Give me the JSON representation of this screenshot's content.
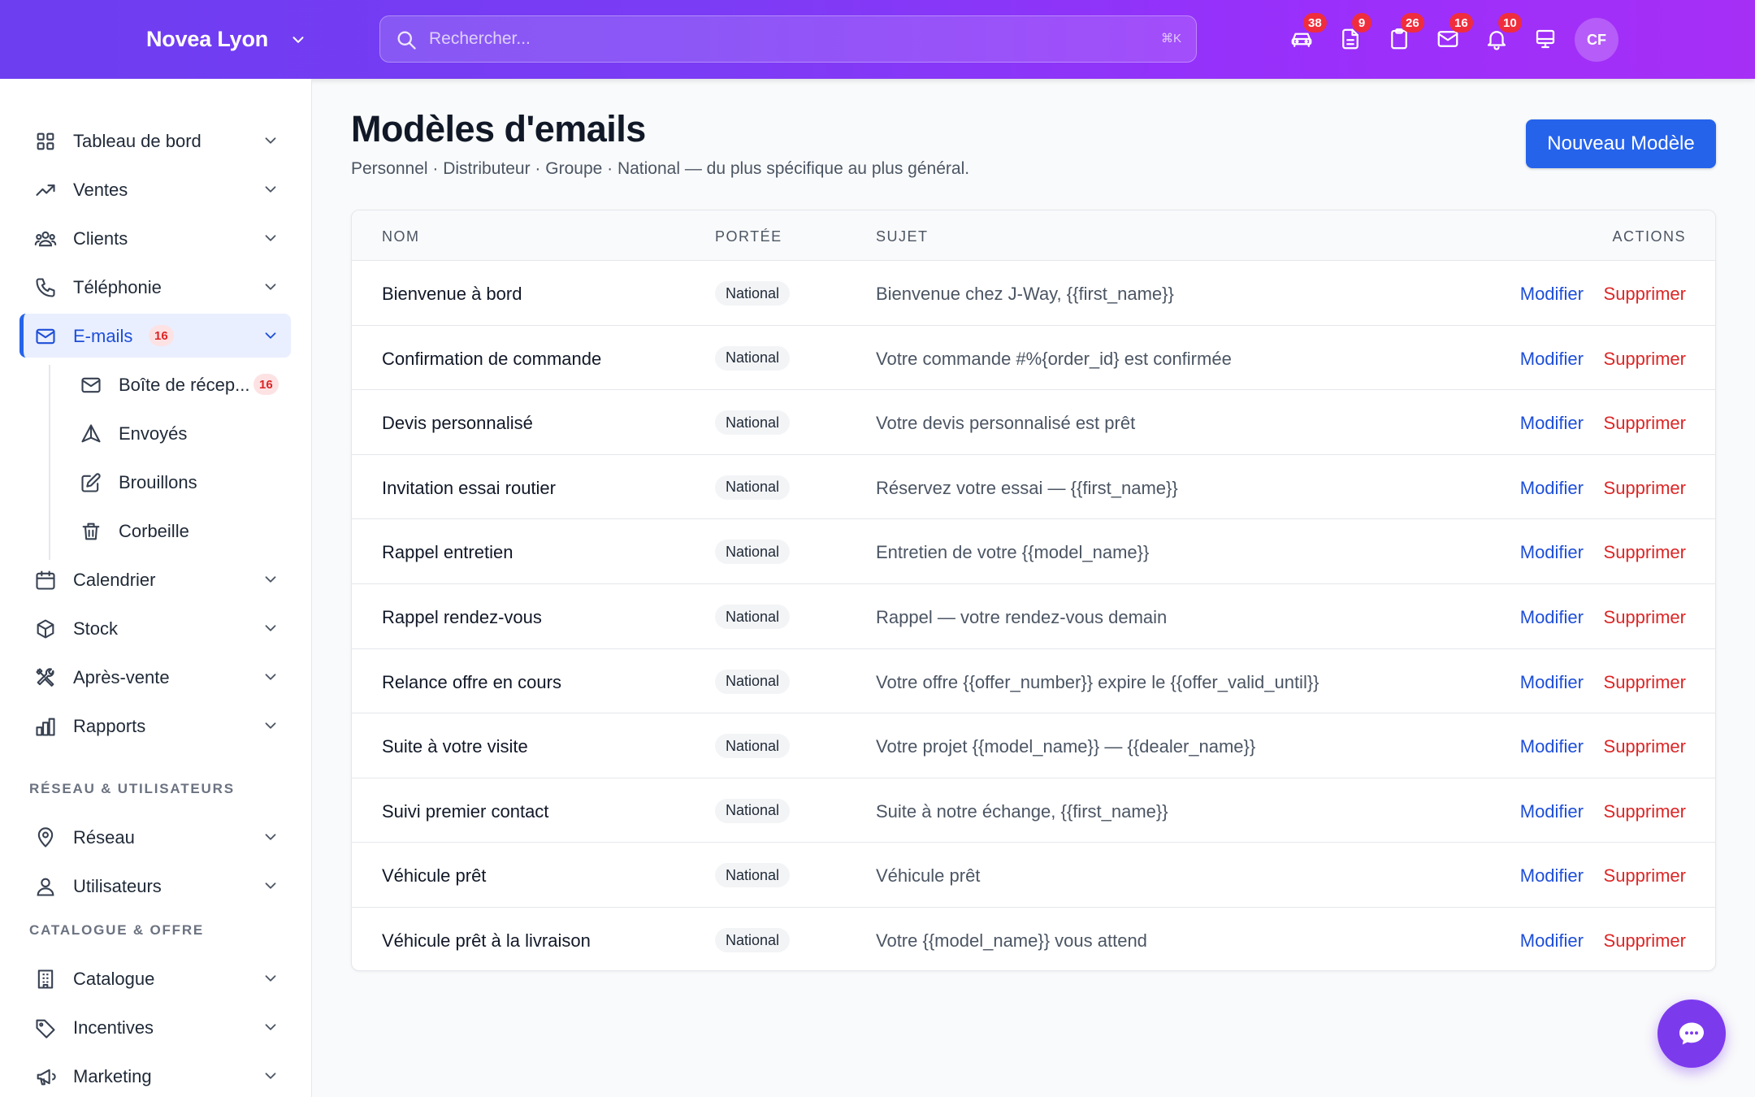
{
  "header": {
    "brand": "Novea Lyon",
    "search_placeholder": "Rechercher...",
    "search_shortcut": "⌘K",
    "icons": [
      {
        "name": "car-icon",
        "badge": "38"
      },
      {
        "name": "document-icon",
        "badge": "9"
      },
      {
        "name": "clipboard-icon",
        "badge": "26"
      },
      {
        "name": "mail-icon",
        "badge": "16"
      },
      {
        "name": "bell-icon",
        "badge": "10"
      },
      {
        "name": "monitor-icon",
        "badge": ""
      }
    ],
    "avatar_initials": "CF"
  },
  "sidebar": {
    "items": [
      {
        "label": "Tableau de bord",
        "icon": "dashboard-icon"
      },
      {
        "label": "Ventes",
        "icon": "trending-icon"
      },
      {
        "label": "Clients",
        "icon": "users-icon"
      },
      {
        "label": "Téléphonie",
        "icon": "phone-icon"
      },
      {
        "label": "E-mails",
        "icon": "mail-icon",
        "badge": "16",
        "active": true
      },
      {
        "label": "Calendrier",
        "icon": "calendar-icon"
      },
      {
        "label": "Stock",
        "icon": "box-icon"
      },
      {
        "label": "Après-vente",
        "icon": "tools-icon"
      },
      {
        "label": "Rapports",
        "icon": "reports-icon"
      }
    ],
    "email_sub": [
      {
        "label": "Boîte de récep...",
        "icon": "inbox-icon",
        "badge": "16"
      },
      {
        "label": "Envoyés",
        "icon": "send-icon"
      },
      {
        "label": "Brouillons",
        "icon": "edit-icon"
      },
      {
        "label": "Corbeille",
        "icon": "trash-icon"
      }
    ],
    "section_network": "RÉSEAU & UTILISATEURS",
    "network_items": [
      {
        "label": "Réseau",
        "icon": "location-icon"
      },
      {
        "label": "Utilisateurs",
        "icon": "user-icon"
      }
    ],
    "section_catalog": "CATALOGUE & OFFRE",
    "catalog_items": [
      {
        "label": "Catalogue",
        "icon": "building-icon"
      },
      {
        "label": "Incentives",
        "icon": "tag-icon"
      },
      {
        "label": "Marketing",
        "icon": "megaphone-icon"
      }
    ]
  },
  "main": {
    "title": "Modèles d'emails",
    "subtitle": "Personnel · Distributeur · Groupe · National — du plus spécifique au plus général.",
    "new_button": "Nouveau Modèle",
    "table": {
      "headers": {
        "name": "NOM",
        "scope": "PORTÉE",
        "subject": "SUJET",
        "actions": "ACTIONS"
      },
      "edit_label": "Modifier",
      "delete_label": "Supprimer",
      "rows": [
        {
          "name": "Bienvenue à bord",
          "scope": "National",
          "subject": "Bienvenue chez J-Way, {{first_name}}"
        },
        {
          "name": "Confirmation de commande",
          "scope": "National",
          "subject": "Votre commande #%{order_id} est confirmée"
        },
        {
          "name": "Devis personnalisé",
          "scope": "National",
          "subject": "Votre devis personnalisé est prêt"
        },
        {
          "name": "Invitation essai routier",
          "scope": "National",
          "subject": "Réservez votre essai — {{first_name}}"
        },
        {
          "name": "Rappel entretien",
          "scope": "National",
          "subject": "Entretien de votre {{model_name}}"
        },
        {
          "name": "Rappel rendez-vous",
          "scope": "National",
          "subject": "Rappel — votre rendez-vous demain"
        },
        {
          "name": "Relance offre en cours",
          "scope": "National",
          "subject": "Votre offre {{offer_number}} expire le {{offer_valid_until}}"
        },
        {
          "name": "Suite à votre visite",
          "scope": "National",
          "subject": "Votre projet {{model_name}} — {{dealer_name}}"
        },
        {
          "name": "Suivi premier contact",
          "scope": "National",
          "subject": "Suite à notre échange, {{first_name}}"
        },
        {
          "name": "Véhicule prêt",
          "scope": "National",
          "subject": "Véhicule prêt"
        },
        {
          "name": "Véhicule prêt à la livraison",
          "scope": "National",
          "subject": "Votre {{model_name}} vous attend"
        }
      ]
    }
  },
  "colors": {
    "primary": "#2563eb",
    "danger": "#dc2626",
    "header_start": "#6d3df0",
    "header_end": "#a62ff6",
    "fab": "#7c3aed"
  }
}
